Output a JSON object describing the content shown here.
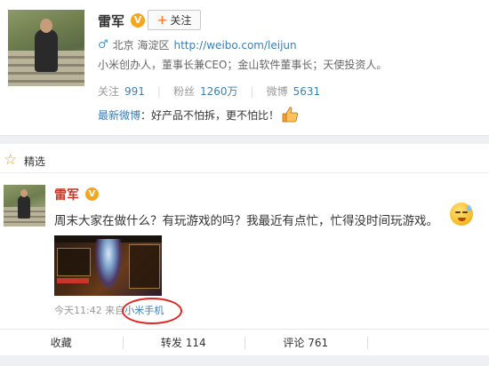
{
  "profile": {
    "name": "雷军",
    "verified_badge": "V",
    "follow_button_label": "关注",
    "location": "北京 海淀区",
    "homepage_url": "http://weibo.com/leijun",
    "bio": "小米创办人，董事长兼CEO；金山软件董事长；天使投资人。",
    "stats": [
      {
        "label": "关注",
        "value": "991"
      },
      {
        "label": "粉丝",
        "value": "1260万"
      },
      {
        "label": "微博",
        "value": "5631"
      }
    ],
    "latest_post_label": "最新微博",
    "latest_post_text": "：好产品不怕拆，更不怕比！"
  },
  "featured": {
    "label": "精选"
  },
  "post": {
    "author": "雷军",
    "verified_badge": "V",
    "text": "周末大家在做什么？有玩游戏的吗？我最近有点忙，忙得没时间玩游戏。",
    "time": "今天11:42",
    "source_prefix": "来自",
    "source": "小米手机"
  },
  "actions": [
    {
      "label": "收藏"
    },
    {
      "label": "转发 114"
    },
    {
      "label": "评论 761"
    },
    {
      "label": ""
    }
  ],
  "colors": {
    "link": "#3a7fb7",
    "author_red": "#c0392b",
    "badge_orange": "#f7a51b",
    "annotation_red": "#e0241f"
  }
}
